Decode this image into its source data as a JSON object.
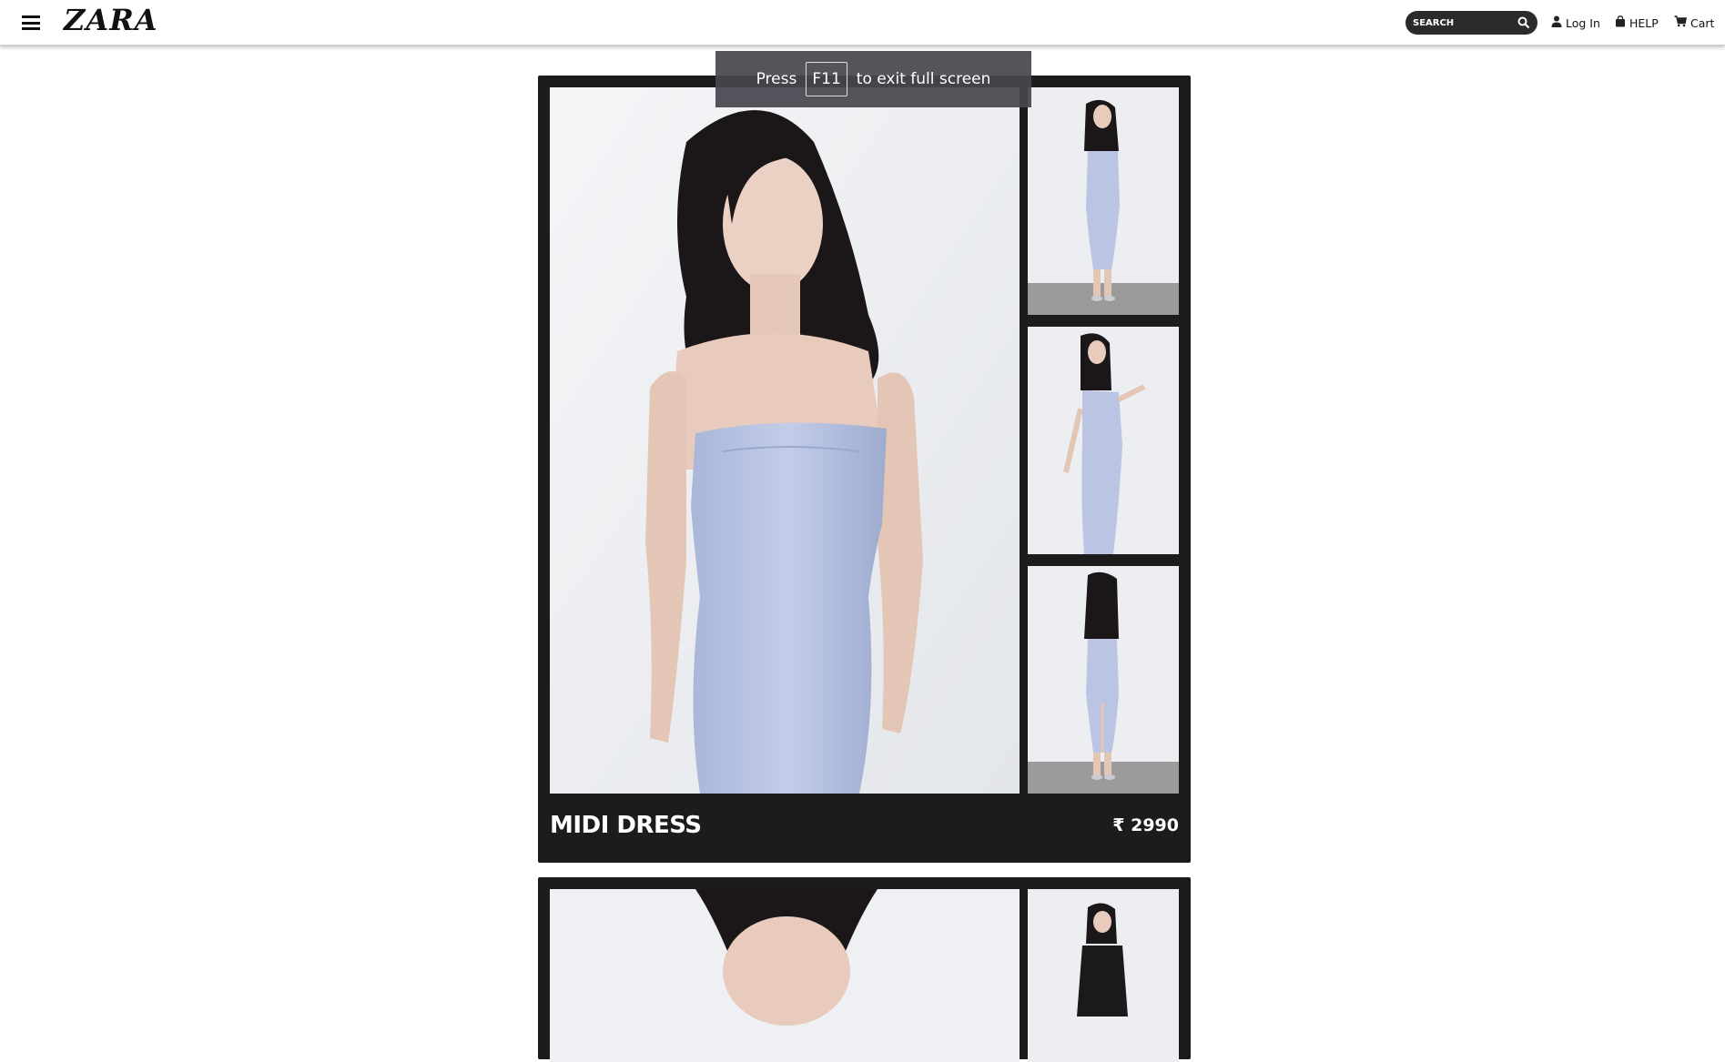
{
  "header": {
    "logo": "ZARA",
    "search_placeholder": "SEARCH",
    "login_label": "Log In",
    "help_label": "HELP",
    "cart_label": "Cart"
  },
  "fullscreen_notice": {
    "press": "Press",
    "key": "F11",
    "rest": "to exit full screen"
  },
  "products": [
    {
      "title": "MIDI DRESS",
      "price": "₹ 2990",
      "dress_color": "#b9c5e3"
    },
    {
      "title": "",
      "price": "",
      "dress_color": "#1a1a1a"
    }
  ]
}
